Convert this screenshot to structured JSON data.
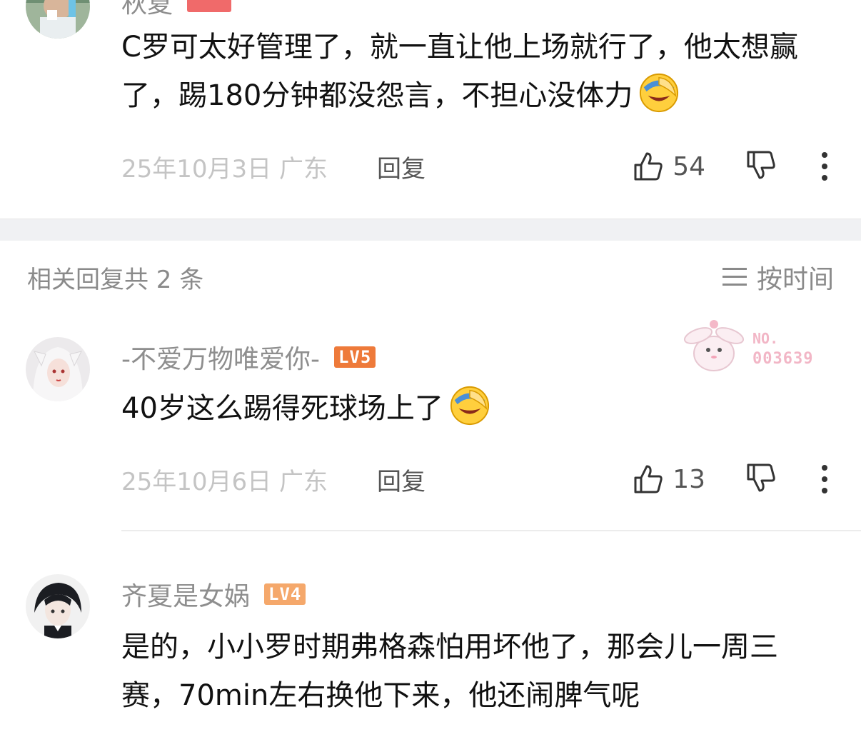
{
  "comments": [
    {
      "username": "秋夏",
      "level": "",
      "text": "C罗可太好管理了，就一直让他上场就行了，他太想赢了，踢180分钟都没怨言，不担心没体力",
      "emoji": "facepalm-laugh-emoji",
      "date": "25年10月3日 广东",
      "reply_label": "回复",
      "likes": "54"
    },
    {
      "username": "-不爱万物唯爱你-",
      "level": "LV5",
      "level_color": "#ee7a3a",
      "text": "40岁这么踢得死球场上了",
      "emoji": "facepalm-laugh-emoji",
      "date": "25年10月6日 广东",
      "reply_label": "回复",
      "likes": "13"
    },
    {
      "username": "齐夏是女娲",
      "level": "LV4",
      "level_color": "#f5a86b",
      "text": "是的，小小罗时期弗格森怕用坏他了，那会儿一周三赛，70min左右换他下来，他还闹脾气呢"
    }
  ],
  "replies_section": {
    "title": "相关回复共 2 条",
    "sort_label": "按时间",
    "sort_icon": "sort-lines-icon"
  },
  "stamp": {
    "no_label": "NO.",
    "number": "003639"
  },
  "colors": {
    "separator_band": "#f0f1f3",
    "muted_text": "#8e8e8e",
    "date_text": "#c4c4c4"
  }
}
